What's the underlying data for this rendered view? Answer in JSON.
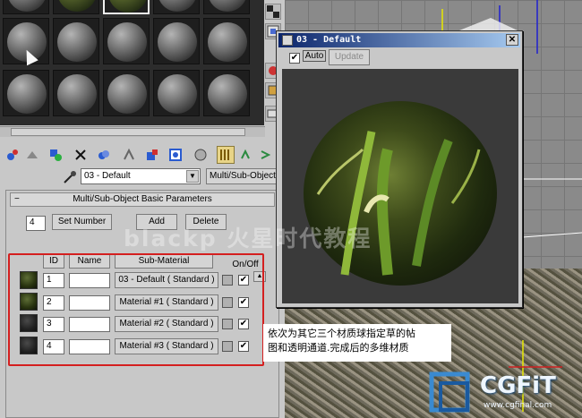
{
  "preview_window": {
    "title": "03 - Default",
    "close_glyph": "✕",
    "auto_label": "Auto",
    "auto_checked": true,
    "update_label": "Update"
  },
  "material": {
    "name": "03 - Default",
    "type_button": "Multi/Sub-Object"
  },
  "rollout": {
    "title": "Multi/Sub-Object Basic Parameters",
    "collapse_glyph": "−",
    "count": "4",
    "set_number_label": "Set Number",
    "add_label": "Add",
    "delete_label": "Delete",
    "col_id": "ID",
    "col_name": "Name",
    "col_submaterial": "Sub-Material",
    "col_onoff": "On/Off",
    "rows": [
      {
        "id": "1",
        "name": "",
        "submaterial": "03 - Default  ( Standard )",
        "on": true
      },
      {
        "id": "2",
        "name": "",
        "submaterial": "Material #1  ( Standard )",
        "on": true
      },
      {
        "id": "3",
        "name": "",
        "submaterial": "Material #2  ( Standard )",
        "on": true
      },
      {
        "id": "4",
        "name": "",
        "submaterial": "Material #3  ( Standard )",
        "on": true
      }
    ]
  },
  "caption": {
    "line1": "依次为其它三个材质球指定草的帖",
    "line2": "图和透明通道.完成后的多维材质"
  },
  "check_glyph": "✔",
  "colors": {
    "highlight": "#d41f1f",
    "title_bar": "#0b246a"
  }
}
